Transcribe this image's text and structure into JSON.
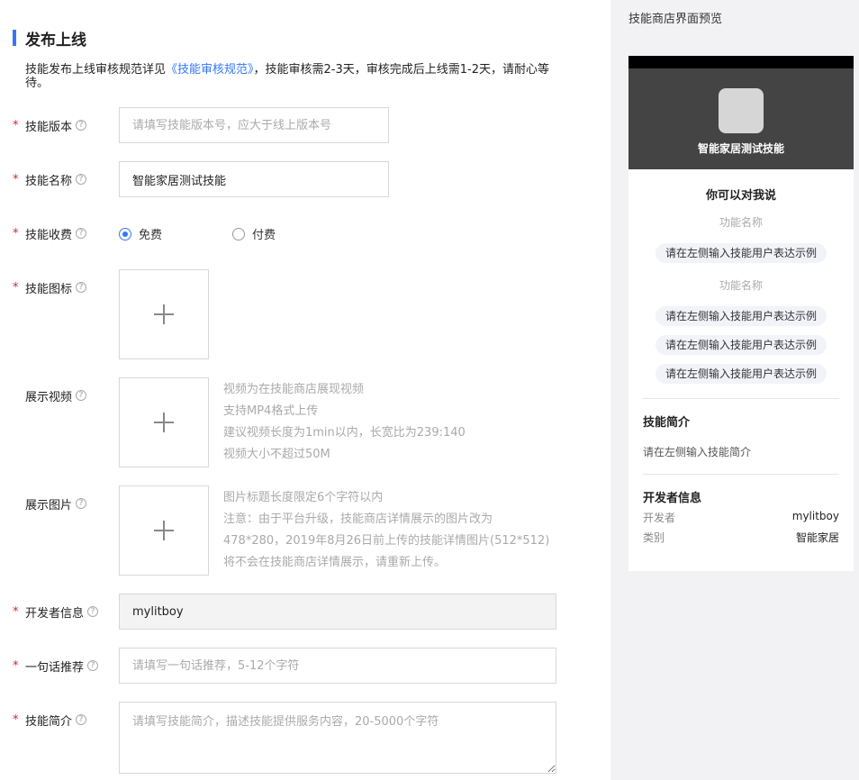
{
  "form": {
    "section_title": "发布上线",
    "notice_prefix": "技能发布上线审核规范详见",
    "notice_link": "《技能审核规范》",
    "notice_suffix": "，技能审核需2-3天，审核完成后上线需1-2天，请耐心等待。",
    "help_glyph": "?",
    "version": {
      "label": "技能版本",
      "placeholder": "请填写技能版本号，应大于线上版本号"
    },
    "name": {
      "label": "技能名称",
      "value": "智能家居测试技能"
    },
    "fee": {
      "label": "技能收费",
      "option_free": "免费",
      "option_paid": "付费"
    },
    "icon": {
      "label": "技能图标"
    },
    "video": {
      "label": "展示视频",
      "hints": [
        "视频为在技能商店展现视频",
        "支持MP4格式上传",
        "建议视频长度为1min以内，长宽比为239:140",
        "视频大小不超过50M"
      ]
    },
    "image": {
      "label": "展示图片",
      "hints": [
        "图片标题长度限定6个字符以内",
        "注意：由于平台升级，技能商店详情展示的图片改为",
        "478*280，2019年8月26日前上传的技能详情图片(512*512)",
        "将不会在技能商店详情展示，请重新上传。"
      ]
    },
    "developer": {
      "label": "开发者信息",
      "value": "mylitboy"
    },
    "slogan": {
      "label": "一句话推荐",
      "placeholder": "请填写一句话推荐，5-12个字符"
    },
    "intro": {
      "label": "技能简介",
      "placeholder": "请填写技能简介，描述技能提供服务内容，20-5000个字符"
    }
  },
  "preview": {
    "title": "技能商店界面预览",
    "app_name": "智能家居测试技能",
    "say_title": "你可以对我说",
    "function_name_1": "功能名称",
    "function_name_2": "功能名称",
    "example_chip": "请在左侧输入技能用户表达示例",
    "intro_title": "技能简介",
    "intro_text": "请在左侧输入技能简介",
    "dev_title": "开发者信息",
    "dev_key": "开发者",
    "dev_value": "mylitboy",
    "cat_key": "类别",
    "cat_value": "智能家居"
  },
  "colors": {
    "accent": "#3478f6",
    "required": "#e02020",
    "hero_bg": "#444444",
    "preview_bg": "#f2f2f4"
  }
}
